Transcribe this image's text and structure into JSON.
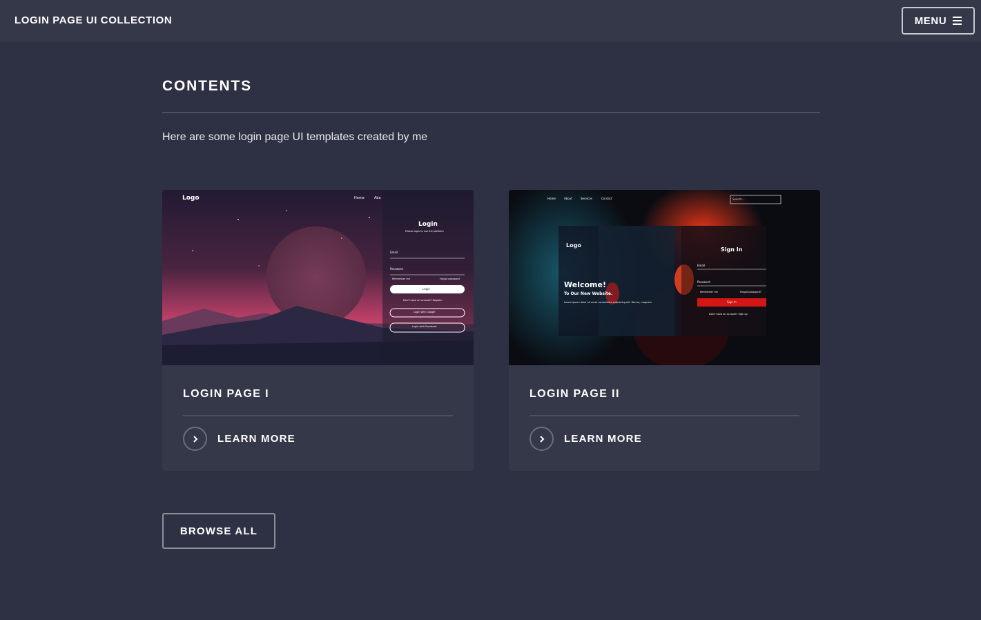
{
  "header": {
    "site_title": "LOGIN PAGE UI COLLECTION",
    "menu_label": "MENU"
  },
  "main": {
    "section_title": "CONTENTS",
    "intro": "Here are some login page UI templates created by me",
    "browse_all_label": "BROWSE ALL"
  },
  "cards": [
    {
      "title": "LOGIN PAGE I",
      "learn_more": "LEARN MORE",
      "preview": {
        "logo": "Logo",
        "nav": [
          "Home",
          "Abo"
        ],
        "form_title": "Login",
        "form_subtitle": "Please login to use the platform",
        "email_label": "Email",
        "password_label": "Password",
        "remember": "Remember me",
        "forgot": "Forgot password",
        "submit": "Login",
        "signup_prompt": "Don't have an account? Register",
        "google": "Login with Google",
        "facebook": "Login with Facebook"
      }
    },
    {
      "title": "LOGIN PAGE II",
      "learn_more": "LEARN MORE",
      "preview": {
        "nav": [
          "Home",
          "About",
          "Services",
          "Contact"
        ],
        "search_placeholder": "Search...",
        "logo": "Logo",
        "welcome": "Welcome!",
        "welcome_sub": "To Our New Website.",
        "body": "Lorem ipsum dolor sit amet consectetur adipiscing elit. Rerum, magnam",
        "form_title": "Sign In",
        "email_label": "Email",
        "password_label": "Password",
        "remember": "Remember me",
        "forgot": "Forgot password?",
        "submit": "Sign In",
        "signup_prompt": "Don't have an account? Sign up"
      }
    }
  ],
  "colors": {
    "background": "#2e3143",
    "header": "#353849",
    "card": "#353849",
    "divider": "#4b4f62",
    "text": "#ffffff"
  },
  "icons": {
    "menu": "hamburger-icon",
    "learn_more": "chevron-right-icon"
  }
}
